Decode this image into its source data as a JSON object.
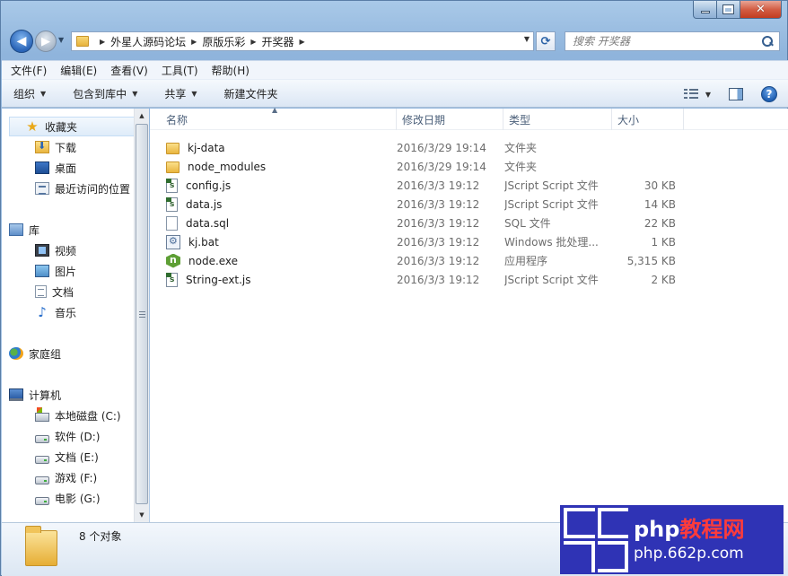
{
  "window": {
    "minimize_glyph": "—",
    "maximize_glyph": "□",
    "close_glyph": "✕"
  },
  "nav": {
    "back_glyph": "◀",
    "forward_glyph": "▶",
    "breadcrumbs": [
      "外星人源码论坛",
      "原版乐彩",
      "开奖器"
    ],
    "crumb_separator": "▶",
    "refresh_glyph": "⟳",
    "search_placeholder": "搜索 开奖器"
  },
  "menubar": {
    "items": [
      "文件(F)",
      "编辑(E)",
      "查看(V)",
      "工具(T)",
      "帮助(H)"
    ]
  },
  "commandbar": {
    "organize": "组织",
    "include_in_library": "包含到库中",
    "share": "共享",
    "new_folder": "新建文件夹",
    "help_glyph": "?"
  },
  "navpane": {
    "favorites": {
      "label": "收藏夹",
      "items": [
        "下载",
        "桌面",
        "最近访问的位置"
      ]
    },
    "libraries": {
      "label": "库",
      "items": [
        "视频",
        "图片",
        "文档",
        "音乐"
      ]
    },
    "homegroup": {
      "label": "家庭组"
    },
    "computer": {
      "label": "计算机",
      "items": [
        "本地磁盘 (C:)",
        "软件 (D:)",
        "文档 (E:)",
        "游戏 (F:)",
        "电影 (G:)"
      ]
    }
  },
  "columns": {
    "name": "名称",
    "date": "修改日期",
    "type": "类型",
    "size": "大小"
  },
  "files": [
    {
      "name": "kj-data",
      "date": "2016/3/29 19:14",
      "type": "文件夹",
      "size": "",
      "icon": "folder-icon"
    },
    {
      "name": "node_modules",
      "date": "2016/3/29 19:14",
      "type": "文件夹",
      "size": "",
      "icon": "folder-icon"
    },
    {
      "name": "config.js",
      "date": "2016/3/3 19:12",
      "type": "JScript Script 文件",
      "size": "30 KB",
      "icon": "jscript-file-icon"
    },
    {
      "name": "data.js",
      "date": "2016/3/3 19:12",
      "type": "JScript Script 文件",
      "size": "14 KB",
      "icon": "jscript-file-icon"
    },
    {
      "name": "data.sql",
      "date": "2016/3/3 19:12",
      "type": "SQL 文件",
      "size": "22 KB",
      "icon": "blank-file-icon"
    },
    {
      "name": "kj.bat",
      "date": "2016/3/3 19:12",
      "type": "Windows 批处理...",
      "size": "1 KB",
      "icon": "batch-file-icon"
    },
    {
      "name": "node.exe",
      "date": "2016/3/3 19:12",
      "type": "应用程序",
      "size": "5,315 KB",
      "icon": "nodejs-app-icon"
    },
    {
      "name": "String-ext.js",
      "date": "2016/3/3 19:12",
      "type": "JScript Script 文件",
      "size": "2 KB",
      "icon": "jscript-file-icon"
    }
  ],
  "status": {
    "item_count": "8 个对象"
  },
  "watermark": {
    "brand": "php",
    "brand_cn": "教程网",
    "url": "php.662p.com",
    "colors": {
      "background": "#2f33b5",
      "accent": "#ff3b3b"
    }
  }
}
